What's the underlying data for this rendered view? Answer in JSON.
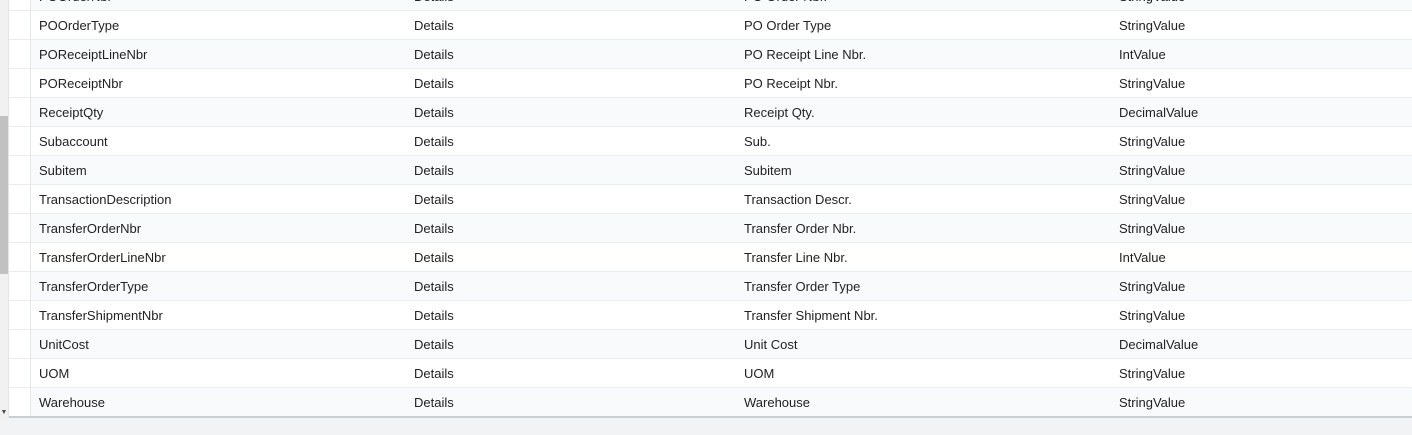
{
  "grid": {
    "rows": [
      {
        "name": "POOrderNbr",
        "object": "Details",
        "display": "PO Order Nbr.",
        "type": "StringValue"
      },
      {
        "name": "POOrderType",
        "object": "Details",
        "display": "PO Order Type",
        "type": "StringValue"
      },
      {
        "name": "POReceiptLineNbr",
        "object": "Details",
        "display": "PO Receipt Line Nbr.",
        "type": "IntValue"
      },
      {
        "name": "POReceiptNbr",
        "object": "Details",
        "display": "PO Receipt Nbr.",
        "type": "StringValue"
      },
      {
        "name": "ReceiptQty",
        "object": "Details",
        "display": "Receipt Qty.",
        "type": "DecimalValue"
      },
      {
        "name": "Subaccount",
        "object": "Details",
        "display": "Sub.",
        "type": "StringValue"
      },
      {
        "name": "Subitem",
        "object": "Details",
        "display": "Subitem",
        "type": "StringValue"
      },
      {
        "name": "TransactionDescription",
        "object": "Details",
        "display": "Transaction Descr.",
        "type": "StringValue"
      },
      {
        "name": "TransferOrderNbr",
        "object": "Details",
        "display": "Transfer Order Nbr.",
        "type": "StringValue"
      },
      {
        "name": "TransferOrderLineNbr",
        "object": "Details",
        "display": "Transfer Line Nbr.",
        "type": "IntValue"
      },
      {
        "name": "TransferOrderType",
        "object": "Details",
        "display": "Transfer Order Type",
        "type": "StringValue"
      },
      {
        "name": "TransferShipmentNbr",
        "object": "Details",
        "display": "Transfer Shipment Nbr.",
        "type": "StringValue"
      },
      {
        "name": "UnitCost",
        "object": "Details",
        "display": "Unit Cost",
        "type": "DecimalValue"
      },
      {
        "name": "UOM",
        "object": "Details",
        "display": "UOM",
        "type": "StringValue"
      },
      {
        "name": "Warehouse",
        "object": "Details",
        "display": "Warehouse",
        "type": "StringValue"
      }
    ]
  },
  "scrollbar": {
    "arrow_icon": "chevron-down-icon"
  }
}
